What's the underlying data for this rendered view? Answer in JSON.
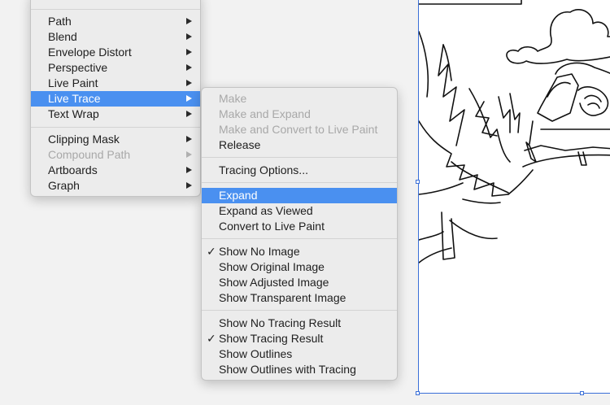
{
  "colors": {
    "highlight": "#4a90f0",
    "menu_bg": "#ececec",
    "artboard_border": "#3a6fd8"
  },
  "object_menu": {
    "items": [
      {
        "label": "Path",
        "submenu": true,
        "state": "normal"
      },
      {
        "label": "Blend",
        "submenu": true,
        "state": "normal"
      },
      {
        "label": "Envelope Distort",
        "submenu": true,
        "state": "normal"
      },
      {
        "label": "Perspective",
        "submenu": true,
        "state": "normal"
      },
      {
        "label": "Live Paint",
        "submenu": true,
        "state": "normal"
      },
      {
        "label": "Live Trace",
        "submenu": true,
        "state": "highlighted"
      },
      {
        "label": "Text Wrap",
        "submenu": true,
        "state": "normal"
      },
      {
        "label": "Clipping Mask",
        "submenu": true,
        "state": "normal"
      },
      {
        "label": "Compound Path",
        "submenu": true,
        "state": "disabled"
      },
      {
        "label": "Artboards",
        "submenu": true,
        "state": "normal"
      },
      {
        "label": "Graph",
        "submenu": true,
        "state": "normal"
      }
    ]
  },
  "live_trace_submenu": {
    "groups": [
      [
        {
          "label": "Make",
          "state": "disabled"
        },
        {
          "label": "Make and Expand",
          "state": "disabled"
        },
        {
          "label": "Make and Convert to Live Paint",
          "state": "disabled"
        },
        {
          "label": "Release",
          "state": "normal"
        }
      ],
      [
        {
          "label": "Tracing Options...",
          "state": "normal"
        }
      ],
      [
        {
          "label": "Expand",
          "state": "highlighted"
        },
        {
          "label": "Expand as Viewed",
          "state": "normal"
        },
        {
          "label": "Convert to Live Paint",
          "state": "normal"
        }
      ],
      [
        {
          "label": "Show No Image",
          "state": "checked"
        },
        {
          "label": "Show Original Image",
          "state": "normal"
        },
        {
          "label": "Show Adjusted Image",
          "state": "normal"
        },
        {
          "label": "Show Transparent Image",
          "state": "normal"
        }
      ],
      [
        {
          "label": "Show No Tracing Result",
          "state": "normal"
        },
        {
          "label": "Show Tracing Result",
          "state": "checked"
        },
        {
          "label": "Show Outlines",
          "state": "normal"
        },
        {
          "label": "Show Outlines with Tracing",
          "state": "normal"
        }
      ]
    ],
    "check_glyph": "✓"
  }
}
